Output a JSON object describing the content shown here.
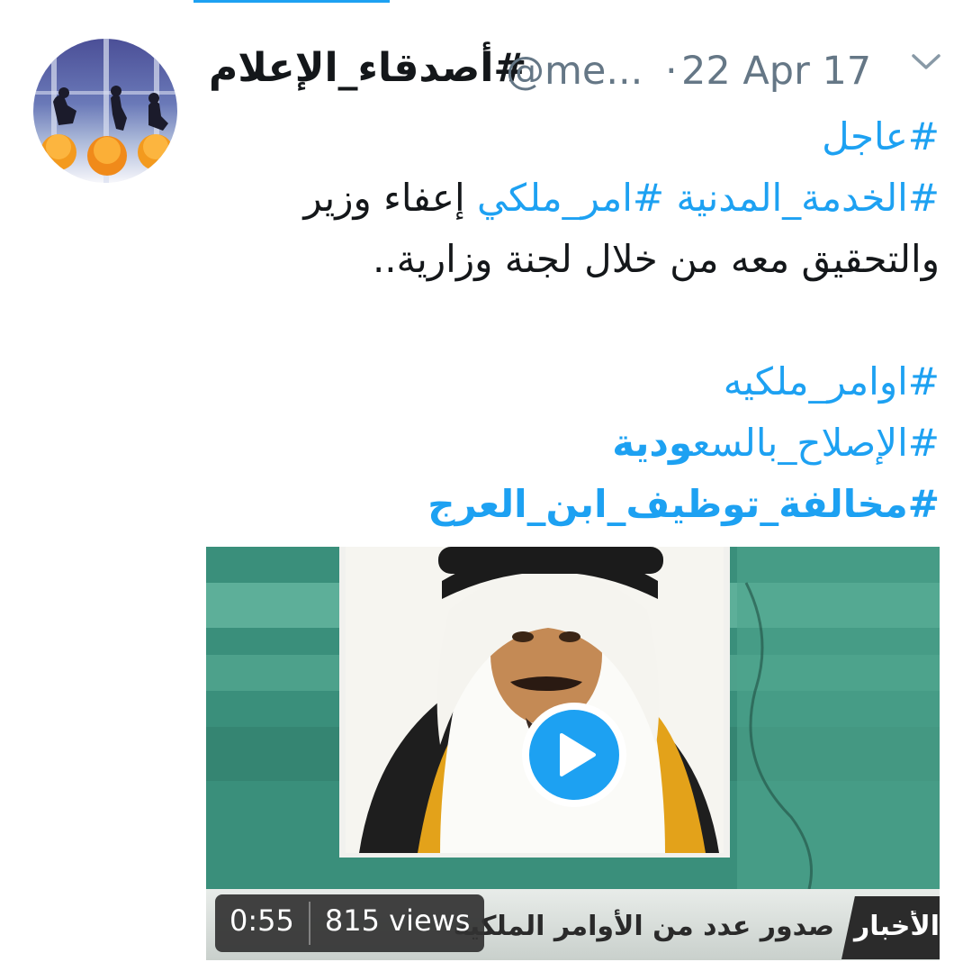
{
  "tweet": {
    "display_name": "#أصدقاء_الإعلام",
    "handle": "@me...",
    "separator": "·",
    "date": "22 Apr 17",
    "lines": [
      [
        {
          "text": "#عاجل",
          "hashtag": true
        }
      ],
      [
        {
          "text": "#الخدمة_المدنية",
          "hashtag": true
        },
        {
          "text": " ",
          "hashtag": false
        },
        {
          "text": "#امر_ملكي",
          "hashtag": true
        },
        {
          "text": " إعفاء وزير",
          "hashtag": false
        }
      ],
      [
        {
          "text": "والتحقيق معه من خلال لجنة وزارية..",
          "hashtag": false
        }
      ],
      [],
      [
        {
          "text": "#اوامر_ملكيه",
          "hashtag": true
        }
      ],
      [
        {
          "text": "#الإصلاح_بالسع",
          "hashtag": true
        },
        {
          "text": "ودية",
          "hashtag": true,
          "bold": true
        }
      ],
      [
        {
          "text": "#مخالفة_توظيف_ابن_العرج",
          "hashtag": true,
          "bold": true
        }
      ]
    ]
  },
  "media": {
    "duration": "0:55",
    "views": "815 views",
    "ticker_text": "صدور عدد من الأوامر الملكية",
    "ticker_badge": "الأخبار"
  },
  "icons": {
    "chevron": "chevron-down-icon",
    "play": "play-icon"
  },
  "colors": {
    "link": "#1da1f2",
    "text": "#14171a",
    "secondary": "#657786",
    "play_button": "#1da1f2"
  }
}
